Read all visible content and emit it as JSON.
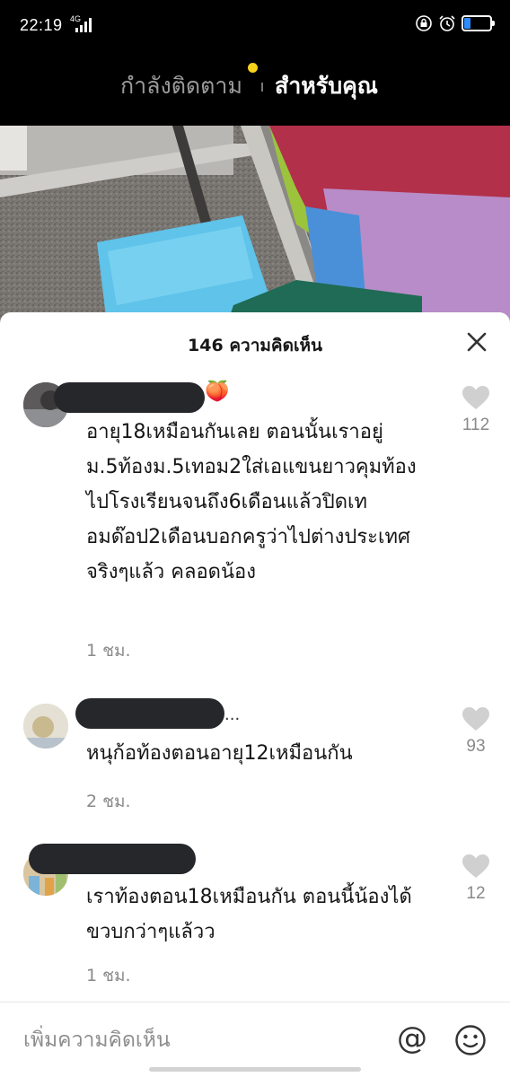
{
  "status_bar": {
    "time": "22:19",
    "network": "4G",
    "battery_level": 0.25,
    "icons": [
      "signal-icon",
      "lock-rotation-icon",
      "alarm-icon",
      "battery-icon"
    ]
  },
  "feed_tabs": {
    "following": "กำลังติดตาม",
    "for_you": "สำหรับคุณ",
    "active": "for_you",
    "dot_color": "#f7d21a"
  },
  "comments_sheet": {
    "title": "146 ความคิดเห็น",
    "comments": [
      {
        "name_emoji": "🍑",
        "text": "อายุ18เหมือนกันเลย ตอนนั้นเราอยู่ม.5ท้องม.5เทอม2ใส่เอแขนยาวคุมท้องไปโรงเรียนจนถึง6เดือนแล้วปิดเทอมด๊อป2เดือนบอกครูว่าไปต่างประเทศจริงๆแล้ว คลอดน้อง",
        "time": "1 ชม.",
        "likes": "112"
      },
      {
        "name_tail": "...",
        "text": "หนุก้อท้องตอนอายุ12เหมือนกัน",
        "time": "2 ชม.",
        "likes": "93"
      },
      {
        "text": "เราท้องตอน18เหมือนกัน ตอนนี้น้องได้ขวบกว่าๆแล้วว",
        "time": "1 ชม.",
        "likes": "12"
      }
    ]
  },
  "input": {
    "placeholder": "เพิ่มความคิดเห็น",
    "at_symbol": "@"
  },
  "colors": {
    "redaction": "#26272b",
    "secondary_text": "#8a8a8a",
    "like_icon": "#d0d0d0"
  }
}
